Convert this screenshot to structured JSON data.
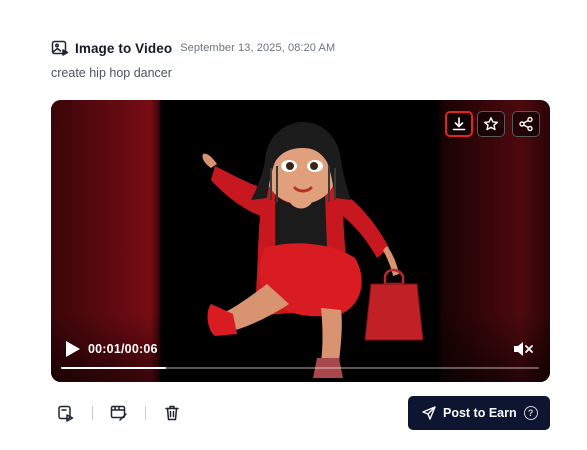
{
  "header": {
    "title": "Image to Video",
    "timestamp": "September 13, 2025, 08:20 AM",
    "icon": "image-video-icon"
  },
  "prompt": "create hip hop dancer",
  "player": {
    "current_time": "00:01",
    "separator": "/",
    "duration": "00:06",
    "progress_fraction": 0.22,
    "controls": {
      "download_icon": "download-icon",
      "favorite_icon": "star-icon",
      "share_icon": "share-icon",
      "play_icon": "play-icon",
      "mute_icon": "volume-muted-icon"
    }
  },
  "toolbar": {
    "items": [
      "image-to-video-icon",
      "edit-video-icon",
      "trash-icon"
    ]
  },
  "earn_button": {
    "label": "Post to Earn",
    "help": "?",
    "icon": "send-icon"
  },
  "colors": {
    "earn_button_bg": "#0e1530",
    "highlight_border": "#e02424",
    "curtain_red": "#7a0c14"
  }
}
